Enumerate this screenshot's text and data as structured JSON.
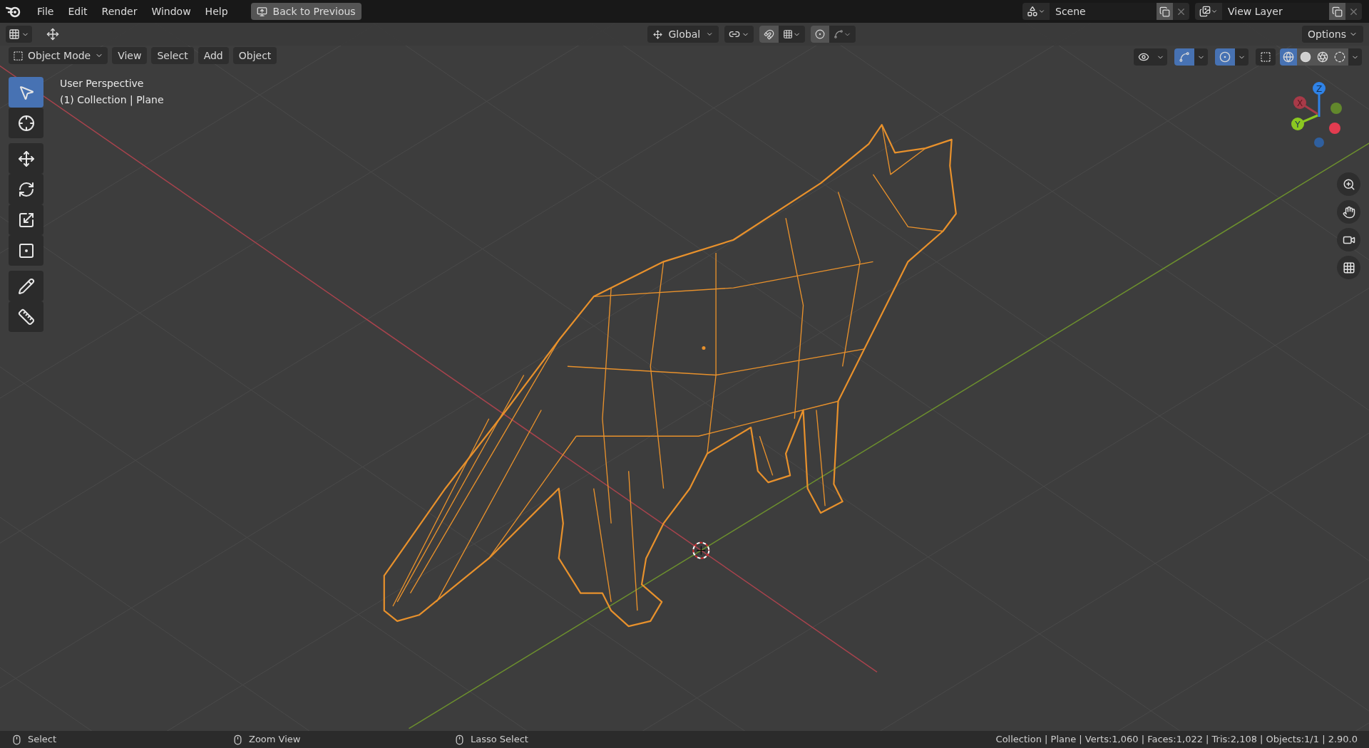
{
  "menu": [
    "File",
    "Edit",
    "Render",
    "Window",
    "Help"
  ],
  "back_button": "Back to Previous",
  "scene": "Scene",
  "view_layer": "View Layer",
  "tool_header": {
    "orientation": "Global",
    "options": "Options"
  },
  "header": {
    "mode": "Object Mode",
    "menus": [
      "View",
      "Select",
      "Add",
      "Object"
    ]
  },
  "toggles": [
    {
      "kind": "visibility",
      "on": false
    },
    {
      "kind": "gizmos",
      "on": true
    },
    {
      "kind": "overlays",
      "on": true
    },
    {
      "kind": "xray",
      "on": false
    }
  ],
  "shading": [
    {
      "kind": "wireframe",
      "selected": true
    },
    {
      "kind": "solid",
      "selected": false
    },
    {
      "kind": "material",
      "selected": false
    },
    {
      "kind": "rendered",
      "selected": false
    }
  ],
  "viewport_info": [
    "User Perspective",
    "(1) Collection | Plane"
  ],
  "tools": [
    {
      "kind": "select",
      "selected": true
    },
    {
      "kind": "cursor",
      "selected": false
    },
    {
      "kind": "move",
      "selected": false
    },
    {
      "kind": "rotate",
      "selected": false
    },
    {
      "kind": "scale",
      "selected": false
    },
    {
      "kind": "transform",
      "selected": false
    },
    {
      "kind": "annotate",
      "selected": false
    },
    {
      "kind": "measure",
      "selected": false
    }
  ],
  "axes": [
    {
      "label": "Z"
    },
    {
      "label": "X"
    },
    {
      "label": "Y"
    }
  ],
  "status_bar": {
    "hints": [
      "Select",
      "Zoom View",
      "Lasso Select"
    ],
    "stats": "Collection | Plane | Verts:1,060 | Faces:1,022 | Tris:2,108 | Objects:1/1 | 2.90.0"
  }
}
